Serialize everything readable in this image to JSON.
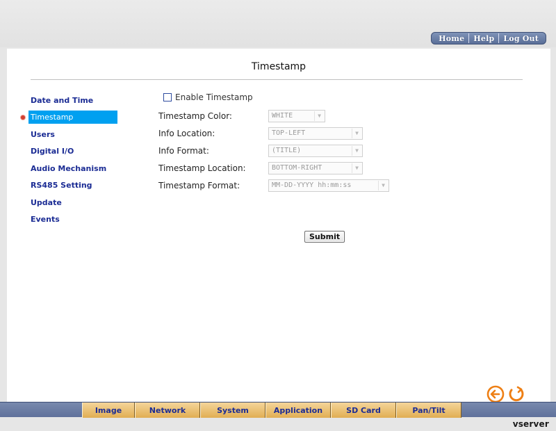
{
  "top_nav": {
    "items": [
      "Home",
      "Help",
      "Log Out"
    ]
  },
  "page": {
    "title": "Timestamp"
  },
  "sidebar": {
    "items": [
      {
        "label": "Date and Time"
      },
      {
        "label": "Timestamp",
        "active": true
      },
      {
        "label": "Users"
      },
      {
        "label": "Digital I/O"
      },
      {
        "label": "Audio Mechanism"
      },
      {
        "label": "RS485 Setting"
      },
      {
        "label": "Update"
      },
      {
        "label": "Events"
      }
    ]
  },
  "form": {
    "enable_label": "Enable Timestamp",
    "enable_checked": false,
    "fields": [
      {
        "label": "Timestamp Color:",
        "value": "WHITE"
      },
      {
        "label": "Info Location:",
        "value": "TOP-LEFT"
      },
      {
        "label": "Info Format:",
        "value": "(TITLE)"
      },
      {
        "label": "Timestamp Location:",
        "value": "BOTTOM-RIGHT"
      },
      {
        "label": "Timestamp Format:",
        "value": "MM-DD-YYYY hh:mm:ss"
      }
    ],
    "submit_label": "Submit"
  },
  "bottom_tabs": [
    "Image",
    "Network",
    "System",
    "Application",
    "SD Card",
    "Pan/Tilt"
  ],
  "brand": "vserver",
  "colors": {
    "accent_active": "#00a0f0",
    "nav_text": "#1b2c94",
    "tab_bg": "#e1ae53",
    "icon_orange": "#ee7f14"
  }
}
